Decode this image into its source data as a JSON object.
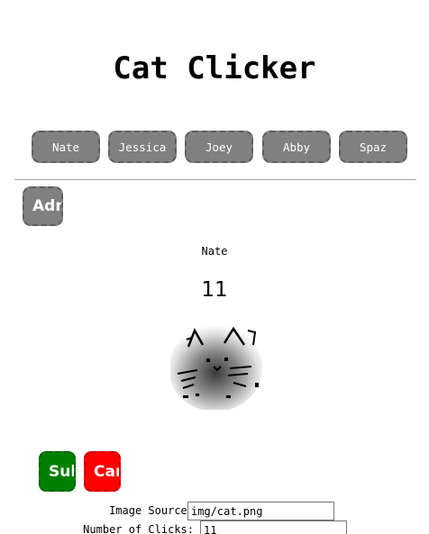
{
  "app": {
    "title": "Cat Clicker"
  },
  "cat_list": [
    {
      "label": "Nate"
    },
    {
      "label": "Jessica"
    },
    {
      "label": "Joey"
    },
    {
      "label": "Abby"
    },
    {
      "label": "Spaz"
    }
  ],
  "admin": {
    "button_label": "Admin"
  },
  "current_cat": {
    "name": "Nate",
    "count": "11",
    "image_icon": "cat-sketch"
  },
  "admin_form": {
    "save_label": "Submit",
    "cancel_label": "Cancel",
    "image_source_label": "Image Source:",
    "image_source_value": "img/cat.png",
    "clicks_label": "Number of Clicks:",
    "clicks_value": "11"
  },
  "colors": {
    "cat_button": "#808080",
    "save": "#008000",
    "cancel": "#ff0000"
  }
}
